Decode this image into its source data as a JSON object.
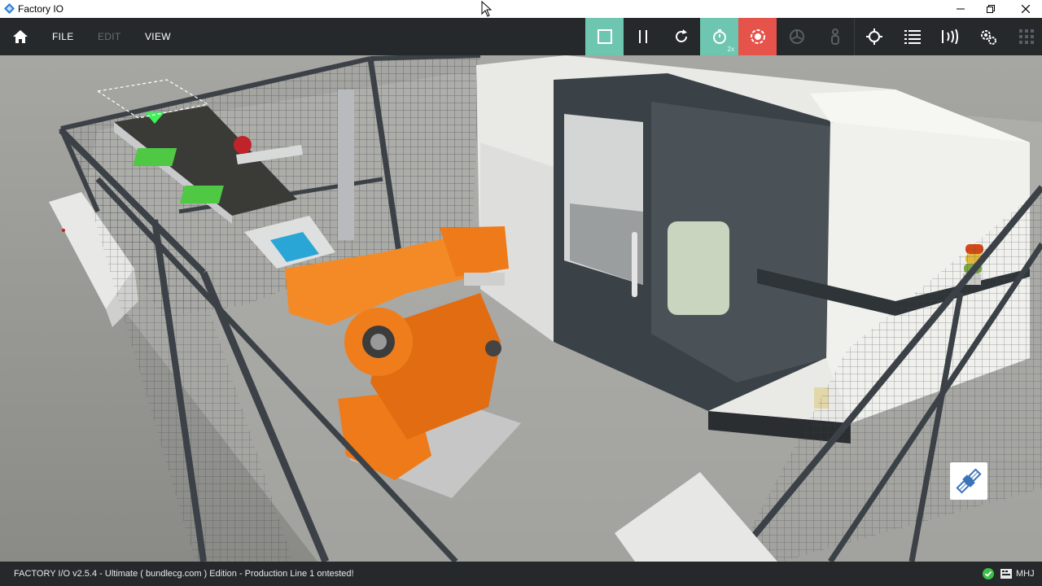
{
  "window": {
    "title": "Factory IO"
  },
  "menu": {
    "file": "FILE",
    "edit": "EDIT",
    "view": "VIEW"
  },
  "toolbar": {
    "speed_badge": "2x",
    "colors": {
      "play_bg": "#6fc6b0",
      "timer_bg": "#6fc6b0",
      "record_bg": "#e5534b",
      "bar_bg": "#25292c",
      "disabled_icon": "#5a5f63"
    },
    "buttons": [
      {
        "icon": "stop-square-icon",
        "state": "active"
      },
      {
        "icon": "pause-icon",
        "state": "enabled"
      },
      {
        "icon": "reset-icon",
        "state": "enabled"
      },
      {
        "icon": "timer-speed-icon",
        "state": "active"
      },
      {
        "icon": "record-icon",
        "state": "active"
      },
      {
        "icon": "fan-icon",
        "state": "disabled"
      },
      {
        "icon": "person-icon",
        "state": "disabled"
      },
      {
        "icon": "crosshair-icon",
        "state": "enabled"
      },
      {
        "icon": "list-icon",
        "state": "enabled"
      },
      {
        "icon": "sensor-icon",
        "state": "enabled"
      },
      {
        "icon": "drivers-gear-icon",
        "state": "enabled"
      },
      {
        "icon": "grid-icon",
        "state": "disabled"
      }
    ]
  },
  "status": {
    "text": "FACTORY I/O v2.5.4 - Ultimate ( bundlecg.com ) Edition - Production Line 1 ontested!",
    "user": "MHJ"
  }
}
